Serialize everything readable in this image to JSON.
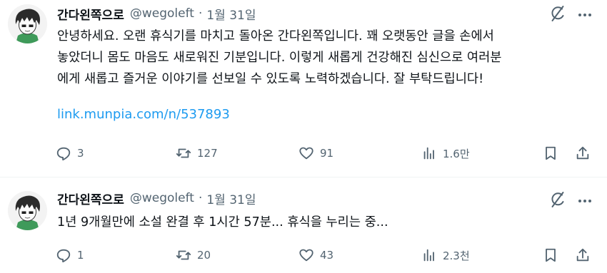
{
  "tweets": [
    {
      "author": "간다왼쪽으로",
      "handle": "@wegoleft",
      "separator": "·",
      "date": "1월 31일",
      "lines": [
        "안녕하세요. 오랜 휴식기를 마치고 돌아온 간다왼쪽입니다. 꽤 오랫동안 글을 손에서",
        "놓았더니 몸도 마음도 새로워진 기분입니다. 이렇게 새롭게 건강해진 심신으로 여러분",
        "에게 새롭고 즐거운 이야기를 선보일 수 있도록 노력하겠습니다. 잘 부탁드립니다!"
      ],
      "link": "link.munpia.com/n/537893",
      "replies": "3",
      "retweets": "127",
      "likes": "91",
      "views": "1.6만"
    },
    {
      "author": "간다왼쪽으로",
      "handle": "@wegoleft",
      "separator": "·",
      "date": "1월 31일",
      "lines": [
        "1년 9개월만에 소설 완결 후 1시간 57분... 휴식을 누리는 중..."
      ],
      "replies": "1",
      "retweets": "20",
      "likes": "43",
      "views": "2.3천"
    }
  ],
  "icons": {
    "reply": "reply-icon",
    "retweet": "retweet-icon",
    "like": "heart-icon",
    "views": "views-bar-chart-icon",
    "bookmark": "bookmark-icon",
    "share": "share-icon",
    "grok": "grok-icon",
    "more": "more-icon"
  },
  "colors": {
    "text": "#0f1419",
    "secondary": "#536471",
    "link": "#1d9bf0",
    "divider": "#eff3f4"
  }
}
